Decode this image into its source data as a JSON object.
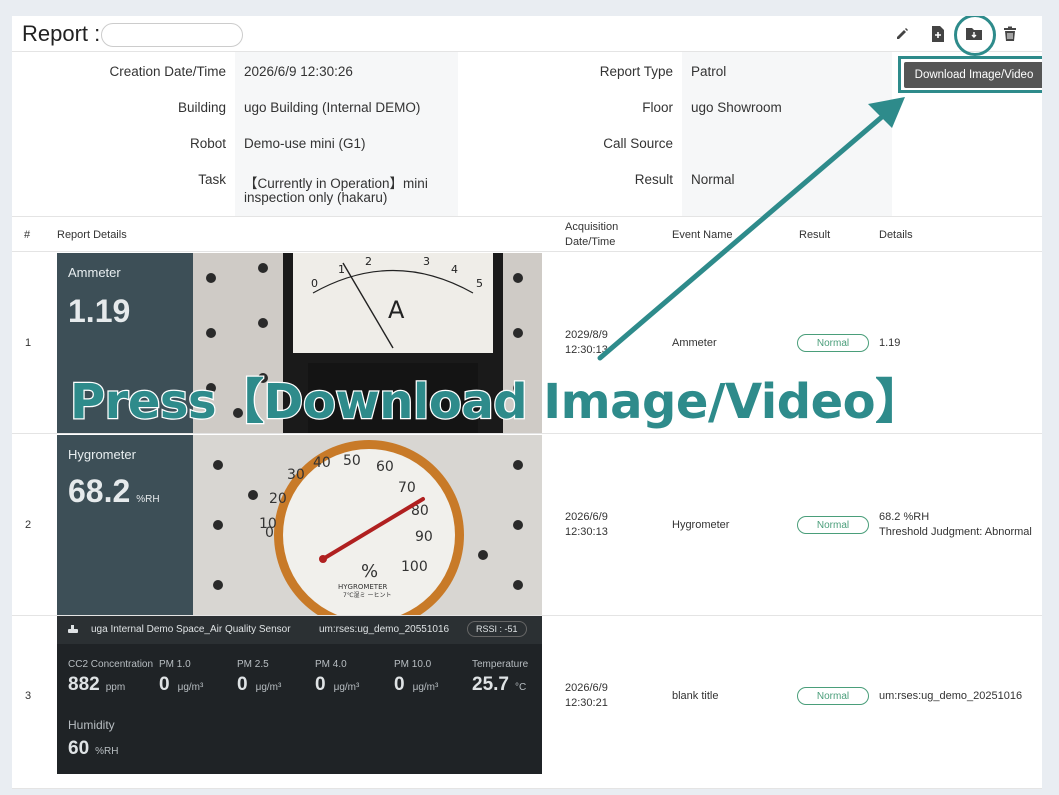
{
  "header": {
    "title": "Report :",
    "tools": [
      "pencil-icon",
      "file-add-icon",
      "folder-download-icon",
      "trash-icon"
    ],
    "download_label": "Download Image/Video"
  },
  "info": {
    "creation_label": "Creation Date/Time",
    "creation_value": "2026/6/9 12:30:26",
    "building_label": "Building",
    "building_value": "ugo Building (Internal DEMO)",
    "robot_label": "Robot",
    "robot_value": "Demo-use mini (G1)",
    "task_label": "Task",
    "task_value_1": "【Currently in Operation】mini",
    "task_value_2": "inspection only (hakaru)",
    "report_type_label": "Report Type",
    "report_type_value": "Patrol",
    "floor_label": "Floor",
    "floor_value": "ugo Showroom",
    "call_source_label": "Call Source",
    "result_label": "Result",
    "result_value": "Normal"
  },
  "table": {
    "headers": {
      "num": "#",
      "details": "Report Details",
      "acq_1": "Acquisition",
      "acq_2": "Date/Time",
      "event": "Event Name",
      "result": "Result",
      "info": "Details"
    },
    "rows": [
      {
        "num": "1",
        "media_label": "Ammeter",
        "media_value": "1.19",
        "date": "2029/8/9",
        "time": "12:30:13",
        "event": "Ammeter",
        "status": "Normal",
        "details_1": "1.19",
        "details_2": ""
      },
      {
        "num": "2",
        "media_label": "Hygrometer",
        "media_value": "68.2",
        "media_unit": "%RH",
        "date": "2026/6/9",
        "time": "12:30:13",
        "event": "Hygrometer",
        "status": "Normal",
        "details_1": "68.2 %RH",
        "details_2": "Threshold Judgment: Abnormal"
      },
      {
        "num": "3",
        "date": "2026/6/9",
        "time": "12:30:21",
        "event": "blank title",
        "status": "Normal",
        "details_1": "um:rses:ug_demo_20251016",
        "details_2": ""
      }
    ]
  },
  "air_quality": {
    "title": "uga Internal Demo Space_Air Quality Sensor",
    "sensor_id": "um:rses:ug_demo_20551016",
    "rssi": "RSSI : -51",
    "metrics": [
      {
        "label": "CC2 Concentration",
        "value": "882",
        "unit": "ppm"
      },
      {
        "label": "PM 1.0",
        "value": "0",
        "unit": "μg/m³"
      },
      {
        "label": "PM 2.5",
        "value": "0",
        "unit": "μg/m³"
      },
      {
        "label": "PM 4.0",
        "value": "0",
        "unit": "μg/m³"
      },
      {
        "label": "PM 10.0",
        "value": "0",
        "unit": "μg/m³"
      },
      {
        "label": "Temperature",
        "value": "25.7",
        "unit": "°C"
      }
    ],
    "humidity": {
      "label": "Humidity",
      "value": "60",
      "unit": "%RH"
    }
  },
  "gauges": {
    "ammeter_letter": "A",
    "ammeter_ticks": [
      "0",
      "1",
      "2",
      "3",
      "4",
      "5"
    ],
    "hygro_ticks": [
      "0",
      "10",
      "20",
      "30",
      "40",
      "50",
      "60",
      "70",
      "80",
      "90",
      "100"
    ],
    "hygro_unit": "%",
    "hygro_brand": "HYGROMETER",
    "hygro_sub": "7℃湿ミ ーヒント"
  },
  "overlay_text": "Press【Download Image/Video】",
  "colors": {
    "accent": "#2e8b8b",
    "status_green": "#4a9e7a",
    "media_side": "#3d4f57"
  }
}
